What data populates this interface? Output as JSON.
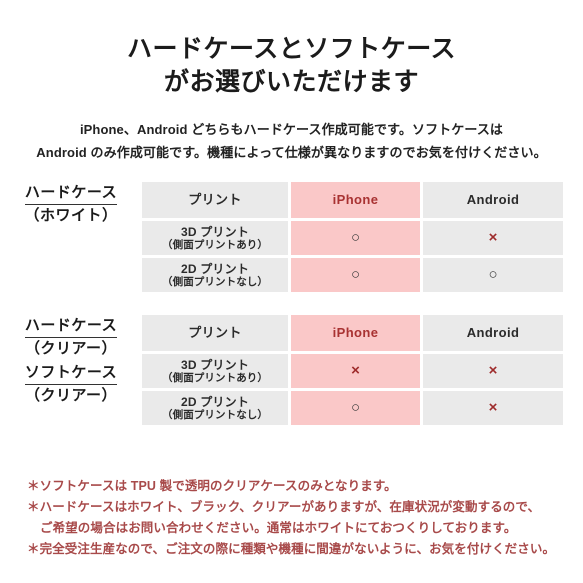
{
  "title": {
    "line1": "ハードケースとソフトケース",
    "line2": "がお選びいただけます"
  },
  "lead": {
    "line1": "iPhone、Android どちらもハードケース作成可能です。ソフトケースは",
    "line2": "Android のみ作成可能です。機種によって仕様が異なりますのでお気を付けください。"
  },
  "colors": {
    "accent_pink": "#fac8c8",
    "cell_gray": "#eaeaea",
    "note_red": "#a84a4a",
    "mark_ng": "#9e2b2b",
    "mark_ok": "#3a3a3a"
  },
  "tables": [
    {
      "labels": [
        {
          "main": "ハードケース",
          "sub": "（ホワイト）"
        }
      ],
      "columns": [
        "プリント",
        "iPhone",
        "Android"
      ],
      "rows": [
        {
          "print_main": "3D プリント",
          "print_sub": "（側面プリントあり）",
          "iphone": "○",
          "android": "×"
        },
        {
          "print_main": "2D プリント",
          "print_sub": "（側面プリントなし）",
          "iphone": "○",
          "android": "○"
        }
      ]
    },
    {
      "labels": [
        {
          "main": "ハードケース",
          "sub": "（クリアー）"
        },
        {
          "main": "ソフトケース",
          "sub": "（クリアー）"
        }
      ],
      "columns": [
        "プリント",
        "iPhone",
        "Android"
      ],
      "rows": [
        {
          "print_main": "3D プリント",
          "print_sub": "（側面プリントあり）",
          "iphone": "×",
          "android": "×"
        },
        {
          "print_main": "2D プリント",
          "print_sub": "（側面プリントなし）",
          "iphone": "○",
          "android": "×"
        }
      ]
    }
  ],
  "notes": [
    "＊ソフトケースは TPU 製で透明のクリアケースのみとなります。",
    "＊ハードケースはホワイト、ブラック、クリアーがありますが、在庫状況が変動するので、",
    "ご希望の場合はお問い合わせください。通常はホワイトにておつくりしております。",
    "＊完全受注生産なので、ご注文の際に種類や機種に間違がないように、お気を付けください。"
  ]
}
